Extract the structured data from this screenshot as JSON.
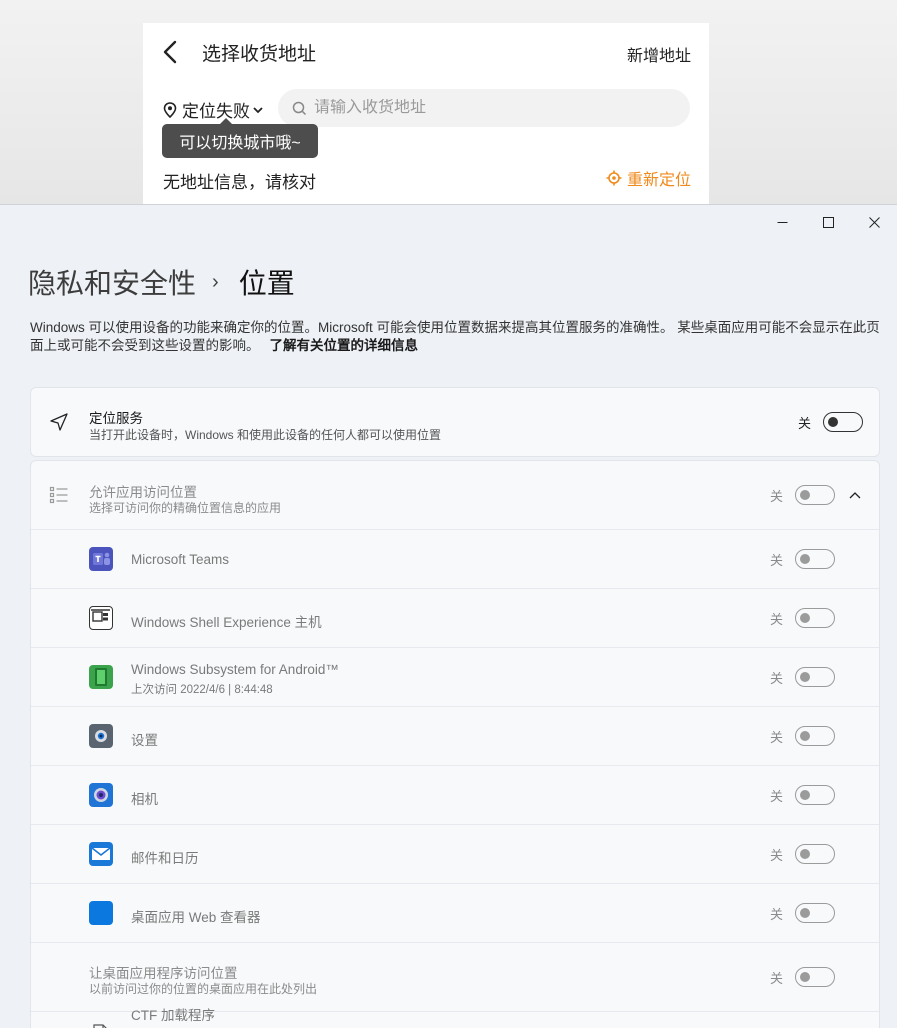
{
  "app": {
    "title": "选择收货地址",
    "new_address": "新增地址",
    "location_status": "定位失败",
    "search_placeholder": "请输入收货地址",
    "tooltip": "可以切换城市哦~",
    "no_address": "无地址信息，请核对",
    "relocate": "重新定位",
    "accent_color": "#f08a1c"
  },
  "window": {
    "controls": [
      "minimize-icon",
      "maximize-icon",
      "close-icon"
    ]
  },
  "settings": {
    "breadcrumb_parent": "隐私和安全性",
    "breadcrumb_sep": "›",
    "breadcrumb_current": "位置",
    "description": "Windows 可以使用设备的功能来确定你的位置。Microsoft 可能会使用位置数据来提高其位置服务的准确性。 某些桌面应用可能不会显示在此页面上或可能不会受到这些设置的影响。",
    "learn_more": "了解有关位置的详细信息",
    "location_service": {
      "title": "定位服务",
      "subtitle": "当打开此设备时，Windows 和使用此设备的任何人都可以使用位置",
      "state": "关"
    },
    "app_access": {
      "title": "允许应用访问位置",
      "subtitle": "选择可访问你的精确位置信息的应用",
      "state": "关"
    },
    "apps": [
      {
        "name": "Microsoft Teams",
        "sub": "",
        "state": "关",
        "icon": "teams-icon"
      },
      {
        "name": "Windows Shell Experience 主机",
        "sub": "",
        "state": "关",
        "icon": "shell-experience-icon"
      },
      {
        "name": "Windows Subsystem for Android™",
        "sub": "上次访问 2022/4/6  |  8:44:48",
        "state": "关",
        "icon": "android-subsystem-icon"
      },
      {
        "name": "设置",
        "sub": "",
        "state": "关",
        "icon": "settings-app-icon"
      },
      {
        "name": "相机",
        "sub": "",
        "state": "关",
        "icon": "camera-app-icon"
      },
      {
        "name": "邮件和日历",
        "sub": "",
        "state": "关",
        "icon": "mail-calendar-icon"
      },
      {
        "name": "桌面应用 Web 查看器",
        "sub": "",
        "state": "关",
        "icon": "web-viewer-icon"
      }
    ],
    "desktop_access": {
      "title": "让桌面应用程序访问位置",
      "subtitle": "以前访问过你的位置的桌面应用在此处列出",
      "state": "关"
    },
    "desktop_apps": [
      {
        "name": "CTF 加载程序"
      }
    ]
  }
}
